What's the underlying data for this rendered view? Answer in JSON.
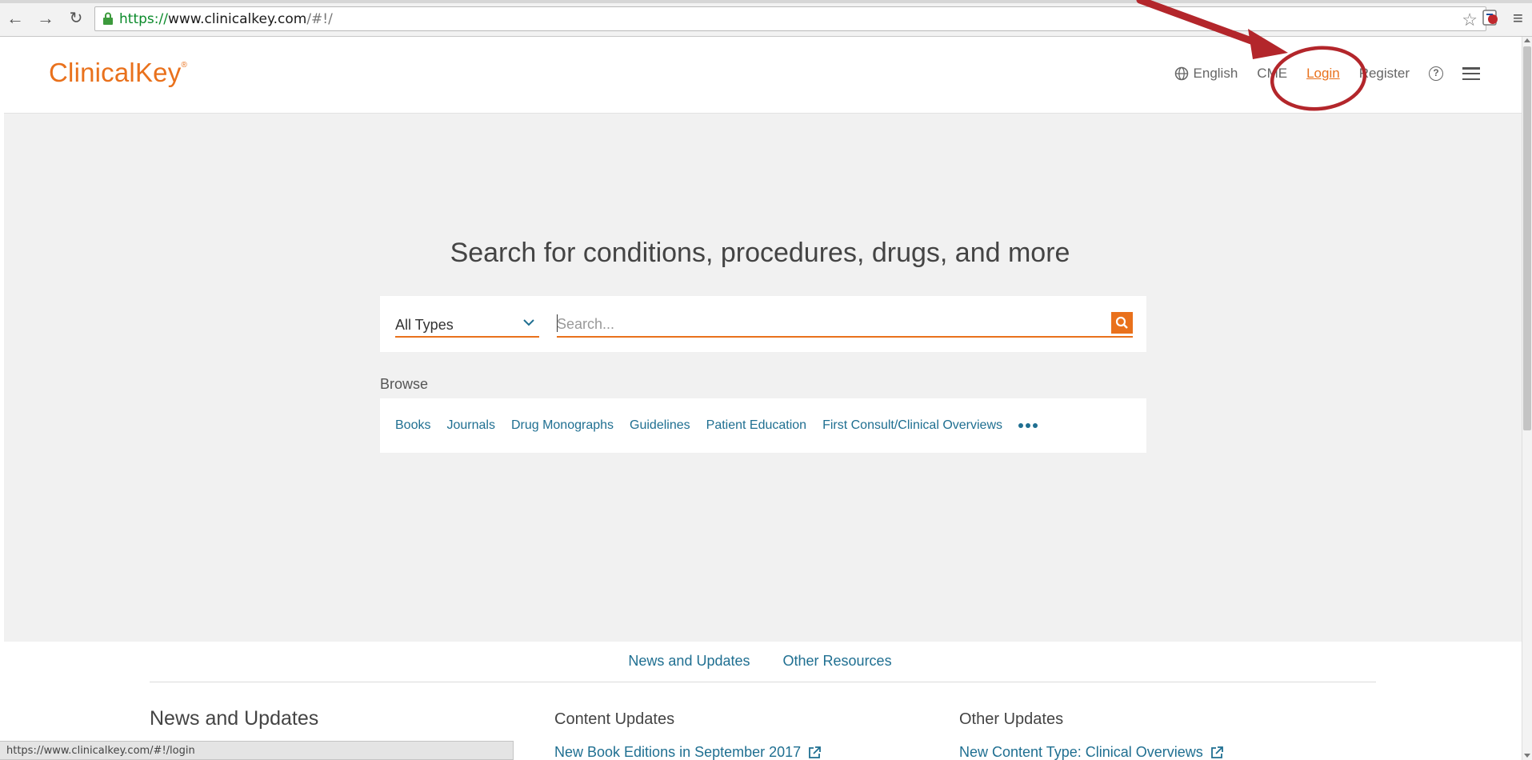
{
  "browser": {
    "url_scheme": "https://",
    "url_host": "www.clinicalkey.com",
    "url_path": "/#!/",
    "back_icon": "back-arrow-icon",
    "forward_icon": "forward-arrow-icon",
    "reload_icon": "reload-icon"
  },
  "header": {
    "logo": "ClinicalKey",
    "logo_mark": "®",
    "language": "English",
    "cme": "CME",
    "login": "Login",
    "register": "Register",
    "help": "?"
  },
  "hero": {
    "title": "Search for conditions, procedures, drugs, and more"
  },
  "search": {
    "type_selected": "All Types",
    "placeholder": "Search..."
  },
  "browse": {
    "label": "Browse",
    "items": [
      "Books",
      "Journals",
      "Drug Monographs",
      "Guidelines",
      "Patient Education",
      "First Consult/Clinical Overviews"
    ]
  },
  "footer": {
    "tabs": [
      "News and Updates",
      "Other Resources"
    ],
    "heading": "News and Updates",
    "columns": [
      {
        "heading": "Content Updates",
        "link": "New Book Editions in September 2017"
      },
      {
        "heading": "Other Updates",
        "link": "New Content Type: Clinical Overviews"
      }
    ]
  },
  "status_bar": {
    "text": "https://www.clinicalkey.com/#!/login"
  },
  "colors": {
    "brand_orange": "#e9711c",
    "link_blue": "#1f6f91",
    "annotation_red": "#b3262b"
  }
}
